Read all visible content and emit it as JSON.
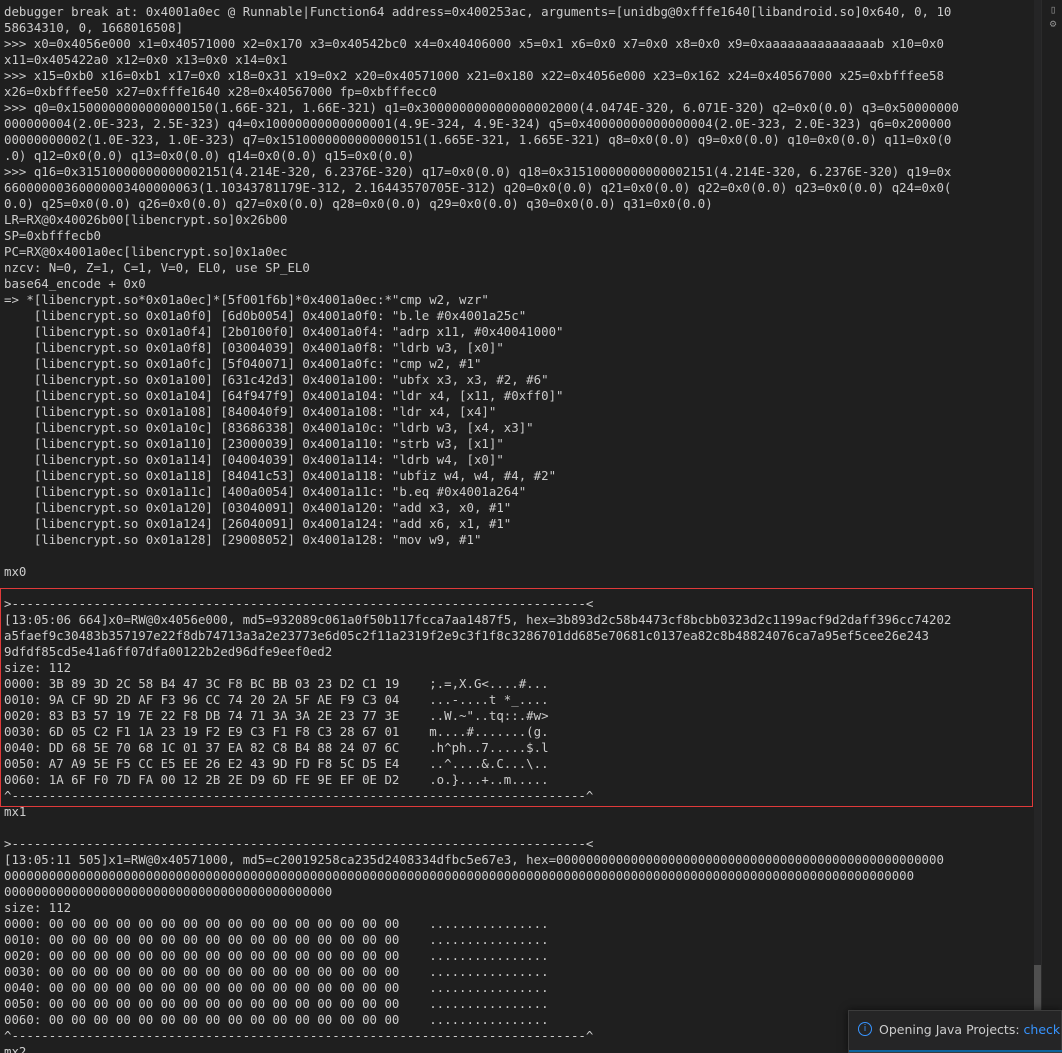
{
  "terminal": {
    "lines": [
      "debugger break at: 0x4001a0ec @ Runnable|Function64 address=0x400253ac, arguments=[unidbg@0xfffe1640[libandroid.so]0x640, 0, 10",
      "58634310, 0, 1668016508]",
      ">>> x0=0x4056e000 x1=0x40571000 x2=0x170 x3=0x40542bc0 x4=0x40406000 x5=0x1 x6=0x0 x7=0x0 x8=0x0 x9=0xaaaaaaaaaaaaaaab x10=0x0",
      "x11=0x405422a0 x12=0x0 x13=0x0 x14=0x1",
      ">>> x15=0xb0 x16=0xb1 x17=0x0 x18=0x31 x19=0x2 x20=0x40571000 x21=0x180 x22=0x4056e000 x23=0x162 x24=0x40567000 x25=0xbfffee58",
      "x26=0xbfffee50 x27=0xfffe1640 x28=0x40567000 fp=0xbfffecc0",
      ">>> q0=0x1500000000000000150(1.66E-321, 1.66E-321) q1=0x300000000000000002000(4.0474E-320, 6.071E-320) q2=0x0(0.0) q3=0x50000000",
      "000000004(2.0E-323, 2.5E-323) q4=0x10000000000000001(4.9E-324, 4.9E-324) q5=0x40000000000000004(2.0E-323, 2.0E-323) q6=0x200000",
      "00000000002(1.0E-323, 1.0E-323) q7=0x1510000000000000151(1.665E-321, 1.665E-321) q8=0x0(0.0) q9=0x0(0.0) q10=0x0(0.0) q11=0x0(0",
      ".0) q12=0x0(0.0) q13=0x0(0.0) q14=0x0(0.0) q15=0x0(0.0)",
      ">>> q16=0x31510000000000002151(4.214E-320, 6.2376E-320) q17=0x0(0.0) q18=0x31510000000000002151(4.214E-320, 6.2376E-320) q19=0x",
      "66000000360000003400000063(1.10343781179E-312, 2.16443570705E-312) q20=0x0(0.0) q21=0x0(0.0) q22=0x0(0.0) q23=0x0(0.0) q24=0x0(",
      "0.0) q25=0x0(0.0) q26=0x0(0.0) q27=0x0(0.0) q28=0x0(0.0) q29=0x0(0.0) q30=0x0(0.0) q31=0x0(0.0)",
      "LR=RX@0x40026b00[libencrypt.so]0x26b00",
      "SP=0xbfffecb0",
      "PC=RX@0x4001a0ec[libencrypt.so]0x1a0ec",
      "nzcv: N=0, Z=1, C=1, V=0, EL0, use SP_EL0",
      "base64_encode + 0x0",
      "=> *[libencrypt.so*0x01a0ec]*[5f001f6b]*0x4001a0ec:*\"cmp w2, wzr\"",
      "    [libencrypt.so 0x01a0f0] [6d0b0054] 0x4001a0f0: \"b.le #0x4001a25c\"",
      "    [libencrypt.so 0x01a0f4] [2b0100f0] 0x4001a0f4: \"adrp x11, #0x40041000\"",
      "    [libencrypt.so 0x01a0f8] [03004039] 0x4001a0f8: \"ldrb w3, [x0]\"",
      "    [libencrypt.so 0x01a0fc] [5f040071] 0x4001a0fc: \"cmp w2, #1\"",
      "    [libencrypt.so 0x01a100] [631c42d3] 0x4001a100: \"ubfx x3, x3, #2, #6\"",
      "    [libencrypt.so 0x01a104] [64f947f9] 0x4001a104: \"ldr x4, [x11, #0xff0]\"",
      "    [libencrypt.so 0x01a108] [840040f9] 0x4001a108: \"ldr x4, [x4]\"",
      "    [libencrypt.so 0x01a10c] [83686338] 0x4001a10c: \"ldrb w3, [x4, x3]\"",
      "    [libencrypt.so 0x01a110] [23000039] 0x4001a110: \"strb w3, [x1]\"",
      "    [libencrypt.so 0x01a114] [04004039] 0x4001a114: \"ldrb w4, [x0]\"",
      "    [libencrypt.so 0x01a118] [84041c53] 0x4001a118: \"ubfiz w4, w4, #4, #2\"",
      "    [libencrypt.so 0x01a11c] [400a0054] 0x4001a11c: \"b.eq #0x4001a264\"",
      "    [libencrypt.so 0x01a120] [03040091] 0x4001a120: \"add x3, x0, #1\"",
      "    [libencrypt.so 0x01a124] [26040091] 0x4001a124: \"add x6, x1, #1\"",
      "    [libencrypt.so 0x01a128] [29008052] 0x4001a128: \"mov w9, #1\"",
      "",
      "mx0",
      "",
      ">-----------------------------------------------------------------------------<",
      "[13:05:06 664]x0=RW@0x4056e000, md5=932089c061a0f50b117fcca7aa1487f5, hex=3b893d2c58b4473cf8bcbb0323d2c1199acf9d2daff396cc74202",
      "a5faef9c30483b357197e22f8db74713a3a2e23773e6d05c2f11a2319f2e9c3f1f8c3286701dd685e70681c0137ea82c8b48824076ca7a95ef5cee26e243",
      "9dfdf85cd5e41a6ff07dfa00122b2ed96dfe9eef0ed2",
      "size: 112",
      "0000: 3B 89 3D 2C 58 B4 47 3C F8 BC BB 03 23 D2 C1 19    ;.=,X.G<....#...",
      "0010: 9A CF 9D 2D AF F3 96 CC 74 20 2A 5F AE F9 C3 04    ...-....t *_....",
      "0020: 83 B3 57 19 7E 22 F8 DB 74 71 3A 3A 2E 23 77 3E    ..W.~\"..tq::.#w>",
      "0030: 6D 05 C2 F1 1A 23 19 F2 E9 C3 F1 F8 C3 28 67 01    m....#.......(g.",
      "0040: DD 68 5E 70 68 1C 01 37 EA 82 C8 B4 88 24 07 6C    .h^ph..7.....$.l",
      "0050: A7 A9 5E F5 CC E5 EE 26 E2 43 9D FD F8 5C D5 E4    ..^....&.C...\\..",
      "0060: 1A 6F F0 7D FA 00 12 2B 2E D9 6D FE 9E EF 0E D2    .o.}...+..m.....",
      "^-----------------------------------------------------------------------------^",
      "mx1",
      "",
      ">-----------------------------------------------------------------------------<",
      "[13:05:11 505]x1=RW@0x40571000, md5=c20019258ca235d2408334dfbc5e67e3, hex=0000000000000000000000000000000000000000000000000000",
      "00000000000000000000000000000000000000000000000000000000000000000000000000000000000000000000000000000000000000000000000000",
      "00000000000000000000000000000000000000000000",
      "size: 112",
      "0000: 00 00 00 00 00 00 00 00 00 00 00 00 00 00 00 00    ................",
      "0010: 00 00 00 00 00 00 00 00 00 00 00 00 00 00 00 00    ................",
      "0020: 00 00 00 00 00 00 00 00 00 00 00 00 00 00 00 00    ................",
      "0030: 00 00 00 00 00 00 00 00 00 00 00 00 00 00 00 00    ................",
      "0040: 00 00 00 00 00 00 00 00 00 00 00 00 00 00 00 00    ................",
      "0050: 00 00 00 00 00 00 00 00 00 00 00 00 00 00 00 00    ................",
      "0060: 00 00 00 00 00 00 00 00 00 00 00 00 00 00 00 00    ................",
      "^-----------------------------------------------------------------------------^",
      "mx2"
    ]
  },
  "notification": {
    "icon": "info-icon",
    "text": "Opening Java Projects: ",
    "link": "check de"
  },
  "colors": {
    "background": "#1f1f1f",
    "text": "#cccccc",
    "highlight_border": "#e03a3a",
    "link": "#3794ff"
  }
}
